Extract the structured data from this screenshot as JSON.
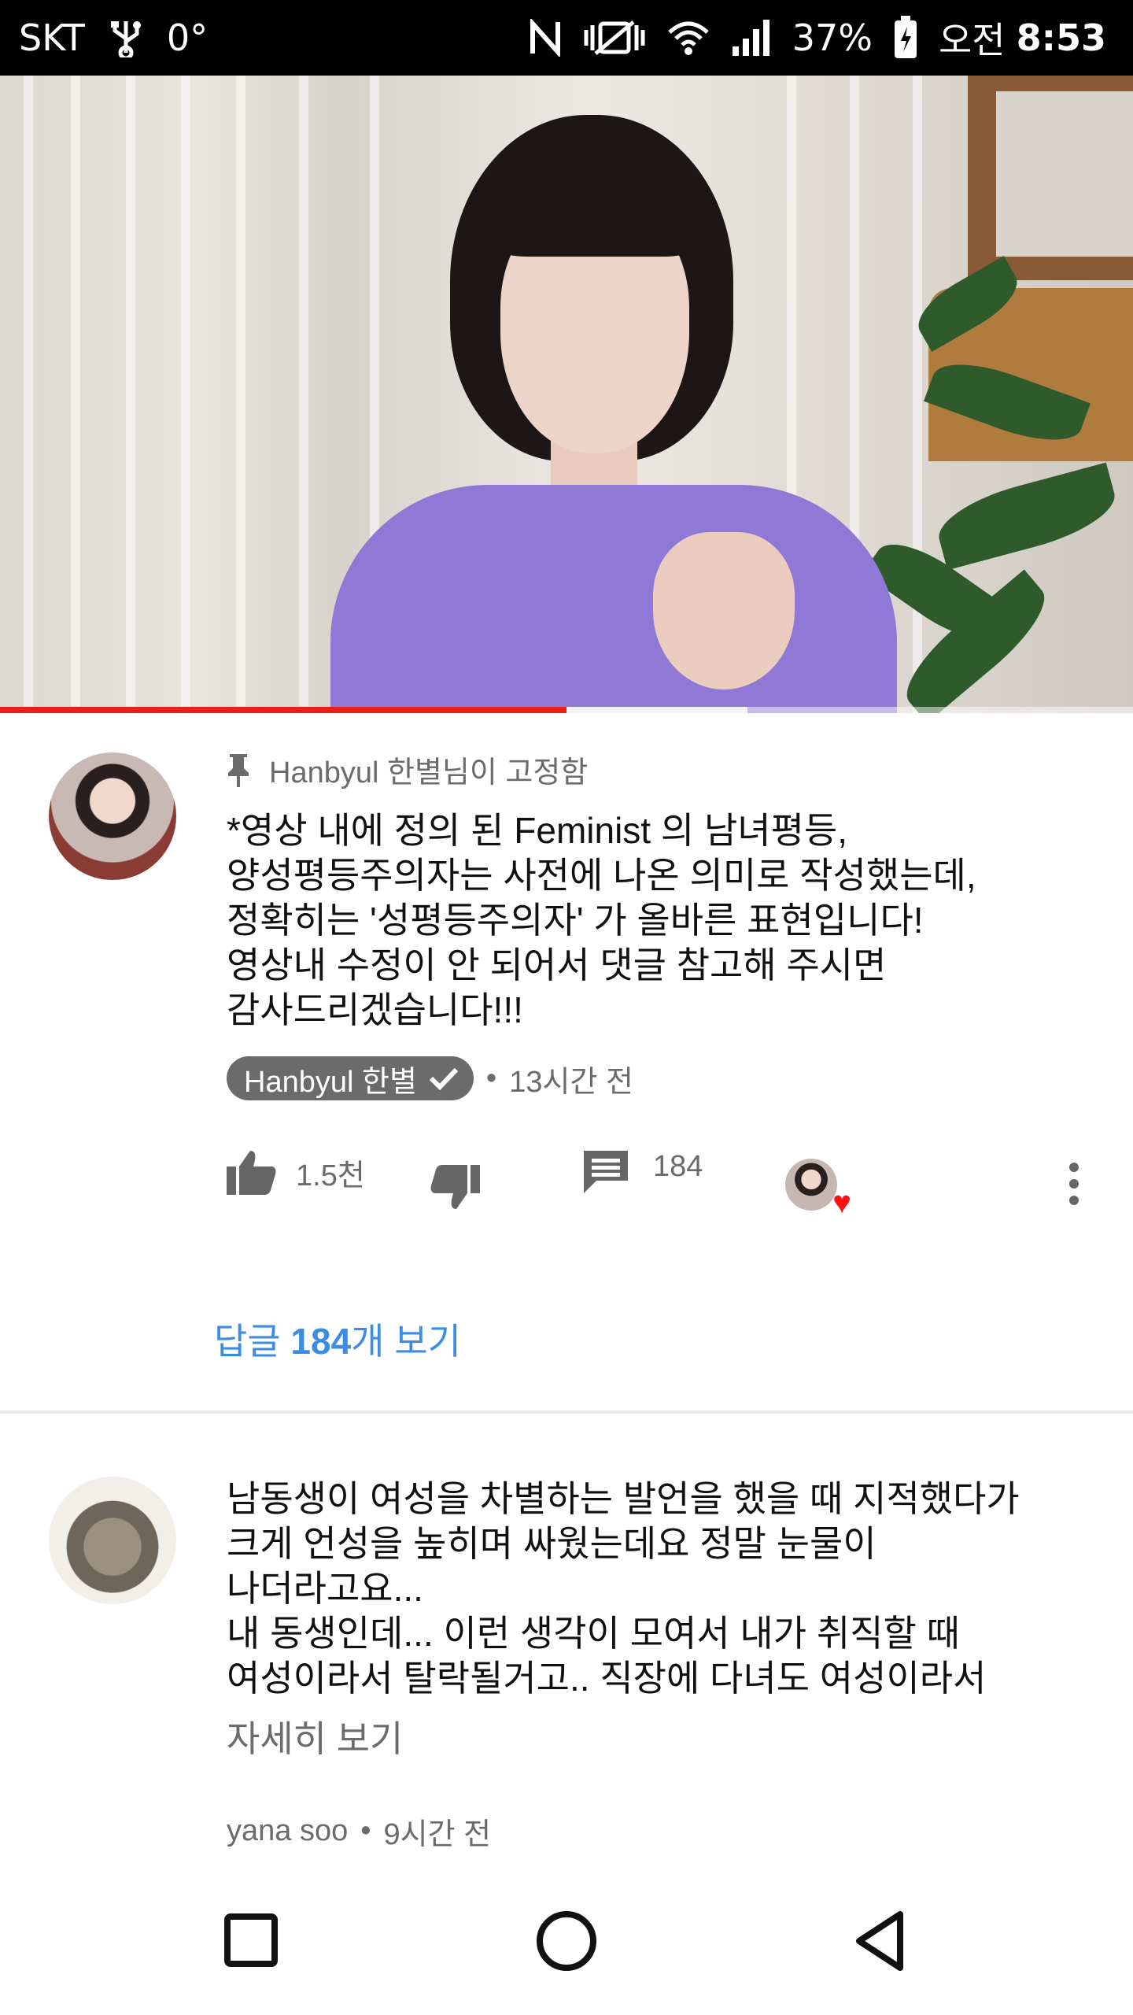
{
  "status_bar": {
    "carrier": "SKT",
    "temperature": "0°",
    "battery": "37%",
    "ampm": "오전",
    "time": "8:53"
  },
  "video": {
    "progress_fraction": 0.5,
    "buffered_fraction": 0.66
  },
  "pinned_comment": {
    "pinned_label": "Hanbyul 한별님이 고정함",
    "text": "*영상 내에 정의 된 Feminist 의 남녀평등,\n양성평등주의자는 사전에 나온 의미로 작성했는데,\n정확히는 '성평등주의자' 가 올바른 표현입니다!\n영상내 수정이 안 되어서 댓글 참고해 주시면\n감사드리겠습니다!!!",
    "author": "Hanbyul 한별",
    "time": "13시간 전",
    "likes": "1.5천",
    "replies_count": "184",
    "view_replies_prefix": "답글 ",
    "view_replies_count": "184",
    "view_replies_suffix": "개 보기"
  },
  "second_comment": {
    "text": "남동생이 여성을 차별하는 발언을 했을 때 지적했다가\n크게 언성을 높히며 싸웠는데요 정말 눈물이\n나더라고요...\n내 동생인데... 이런 생각이 모여서 내가 취직할 때\n여성이라서 탈락될거고.. 직장에 다녀도 여성이라서",
    "read_more": "자세히 보기",
    "author": "yana soo",
    "time": "9시간 전"
  },
  "colors": {
    "progress": "#e62117",
    "link": "#3b8ce3",
    "heart": "#ff1010"
  },
  "icons": {
    "pin": "pin-icon",
    "like": "thumbs-up-icon",
    "dislike": "thumbs-down-icon",
    "reply": "comment-icon",
    "more": "more-vert-icon",
    "verified": "check-icon"
  }
}
